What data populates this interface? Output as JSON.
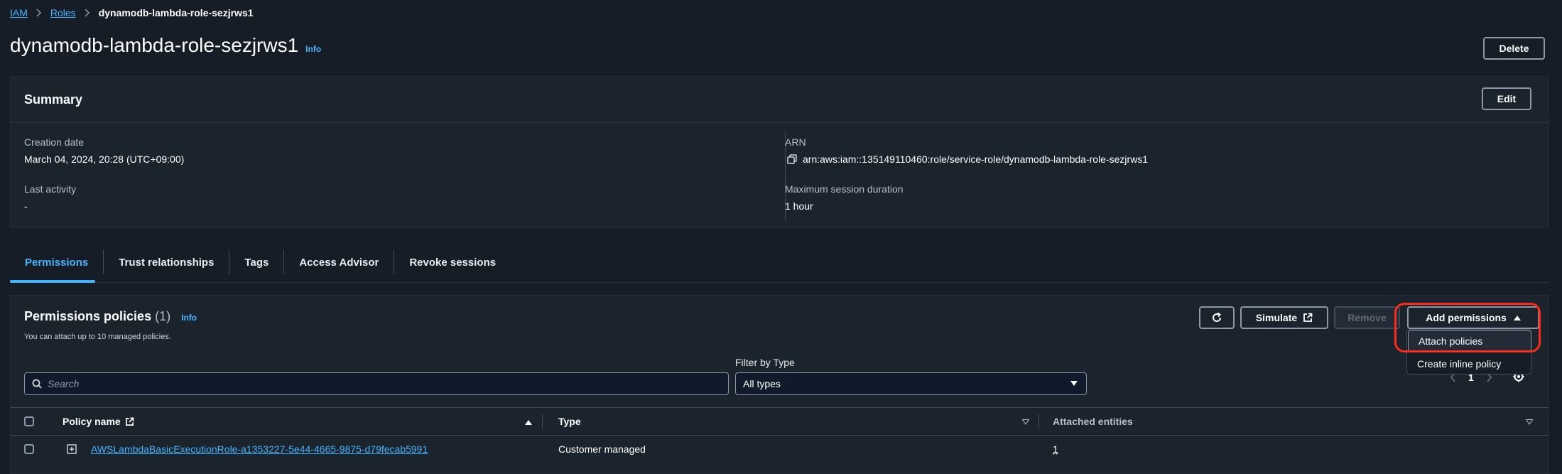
{
  "breadcrumb": {
    "items": [
      "IAM",
      "Roles"
    ],
    "current": "dynamodb-lambda-role-sezjrws1"
  },
  "header": {
    "title": "dynamodb-lambda-role-sezjrws1",
    "info": "Info",
    "delete_label": "Delete"
  },
  "summary": {
    "title": "Summary",
    "edit_label": "Edit",
    "creation_date_label": "Creation date",
    "creation_date": "March 04, 2024, 20:28 (UTC+09:00)",
    "last_activity_label": "Last activity",
    "last_activity": "-",
    "arn_label": "ARN",
    "arn": "arn:aws:iam::135149110460:role/service-role/dynamodb-lambda-role-sezjrws1",
    "max_session_label": "Maximum session duration",
    "max_session": "1 hour"
  },
  "tabs": [
    "Permissions",
    "Trust relationships",
    "Tags",
    "Access Advisor",
    "Revoke sessions"
  ],
  "permissions": {
    "title": "Permissions policies",
    "count": "(1)",
    "info": "Info",
    "subtitle": "You can attach up to 10 managed policies.",
    "simulate_label": "Simulate",
    "remove_label": "Remove",
    "add_permissions_label": "Add permissions",
    "filter_label": "Filter by Type",
    "search_placeholder": "Search",
    "filter_value": "All types",
    "page": "1",
    "dropdown": [
      "Attach policies",
      "Create inline policy"
    ],
    "columns": [
      "Policy name",
      "Type",
      "Attached entities"
    ],
    "rows": [
      {
        "name": "AWSLambdaBasicExecutionRole-a1353227-5e44-4665-9875-d79fecab5991",
        "type": "Customer managed",
        "entities": "1"
      }
    ]
  },
  "colors": {
    "background": "#161d26",
    "panel": "#1b232d",
    "link": "#42b4ff",
    "highlight": "#ff2a1a"
  }
}
